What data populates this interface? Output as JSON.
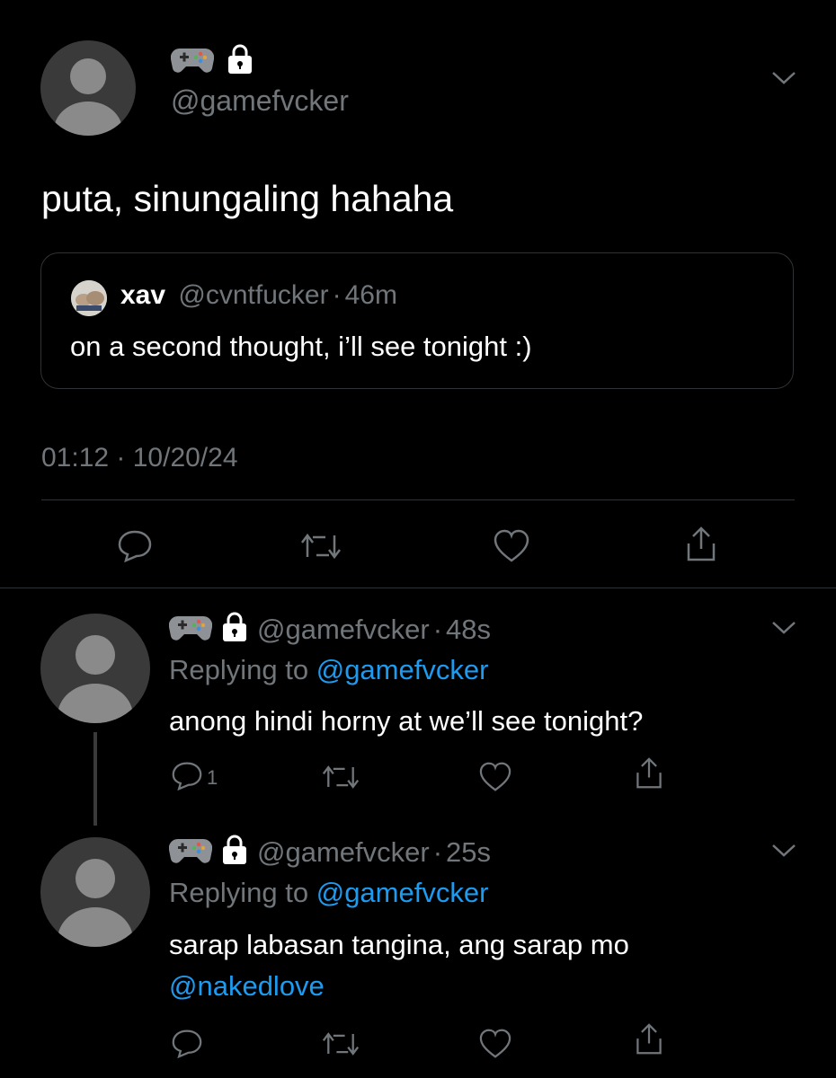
{
  "main_tweet": {
    "display_name_icons": [
      "gamepad-icon",
      "lock-icon"
    ],
    "handle": "@gamefvcker",
    "text": "puta, sinungaling hahaha",
    "timestamp": "01:12 · 10/20/24",
    "quoted": {
      "name": "xav",
      "handle": "@cvntfucker",
      "sep": "·",
      "time": "46m",
      "text": "on a second thought, i’ll see tonight :)"
    }
  },
  "replies": [
    {
      "handle": "@gamefvcker",
      "sep": "·",
      "time": "48s",
      "replying_prefix": "Replying to",
      "replying_to": "@gamefvcker",
      "text": "anong hindi horny at we’ll see tonight?",
      "reply_count": "1"
    },
    {
      "handle": "@gamefvcker",
      "sep": "·",
      "time": "25s",
      "replying_prefix": "Replying to",
      "replying_to": "@gamefvcker",
      "text": "sarap labasan tangina, ang sarap mo",
      "mention": "@nakedlove"
    }
  ],
  "colors": {
    "background": "#000000",
    "text": "#e7e9ea",
    "secondary": "#71767b",
    "link": "#1d9bf0",
    "divider": "#2f3336"
  }
}
